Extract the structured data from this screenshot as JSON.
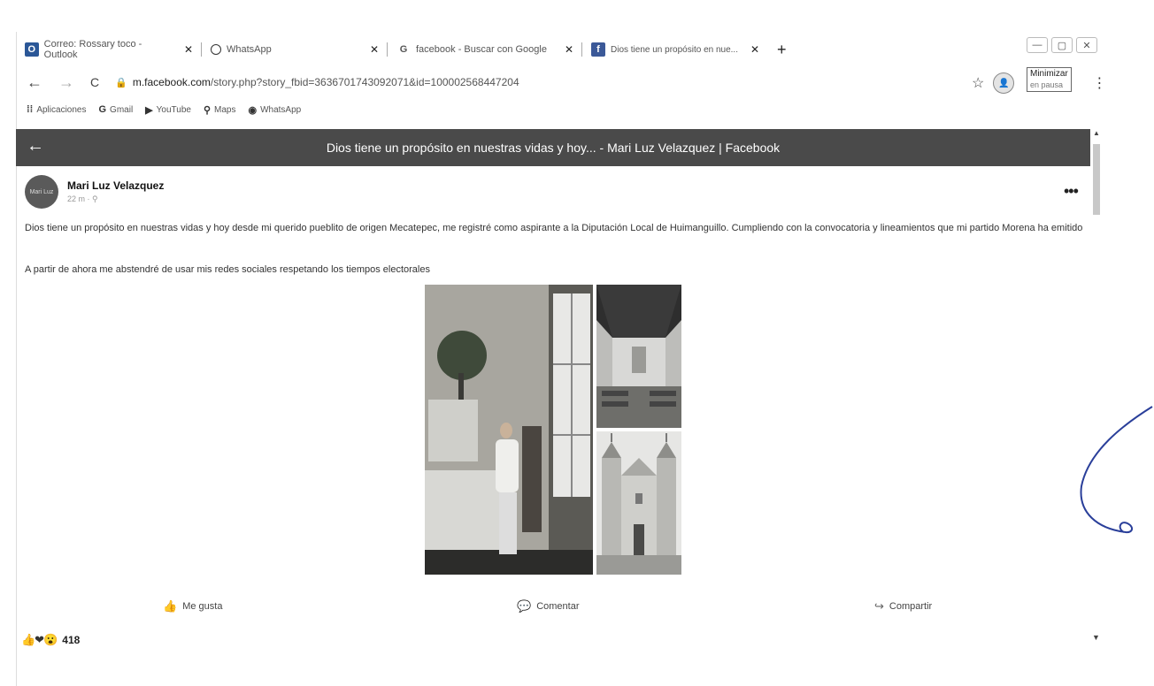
{
  "tabs": [
    {
      "icon": "outlook-icon",
      "label": "Correo: Rossary toco - Outlook",
      "close": "✕"
    },
    {
      "icon": "whatsapp-icon",
      "label": "WhatsApp",
      "close": "✕"
    },
    {
      "icon": "google-icon",
      "label": "facebook - Buscar con Google",
      "close": "✕"
    },
    {
      "icon": "facebook-icon",
      "label": "Dios tiene un propósito en nue...",
      "close": "✕"
    }
  ],
  "new_tab": "+",
  "window_controls": {
    "minimize": "—",
    "restore": "▢",
    "close": "✕"
  },
  "tooltip": {
    "label": "Minimizar",
    "sub": "en pausa"
  },
  "address": {
    "back": "←",
    "forward": "→",
    "reload": "C",
    "host": "m.facebook.com",
    "path": "/story.php?story_fbid=3636701743092071&id=100002568447204"
  },
  "bookmarks": [
    {
      "icon": "apps-icon",
      "glyph": "⁞⁞",
      "label": "Aplicaciones"
    },
    {
      "icon": "google-icon",
      "glyph": "G",
      "label": "Gmail"
    },
    {
      "icon": "youtube-icon",
      "glyph": "▶",
      "label": "YouTube"
    },
    {
      "icon": "maps-icon",
      "glyph": "⚲",
      "label": "Maps"
    },
    {
      "icon": "whatsapp-icon",
      "glyph": "◉",
      "label": "WhatsApp"
    }
  ],
  "fb_header": {
    "back": "←",
    "title": "Dios tiene un propósito en nuestras vidas y hoy... - Mari Luz Velazquez | Facebook"
  },
  "post": {
    "author": "Mari Luz Velazquez",
    "time": "22 m · ⚲",
    "avatar_text": "Mari Luz",
    "more": "•••",
    "text": "Dios tiene un propósito en nuestras vidas y hoy desde mi querido pueblito de origen Mecatepec, me registré como aspirante a la Diputación Local de Huimanguillo. Cumpliendo con la convocatoria y lineamientos que mi partido Morena ha emitido",
    "text2": "A partir de ahora me abstendré de usar mis redes sociales respetando los tiempos electorales"
  },
  "actions": {
    "like": "Me gusta",
    "comment": "Comentar",
    "share": "Compartir"
  },
  "reactions": {
    "icons": "👍❤😮",
    "count": "418"
  },
  "colors": {
    "header_bg": "#4a4a4a",
    "scribble": "#2a3f9a"
  }
}
